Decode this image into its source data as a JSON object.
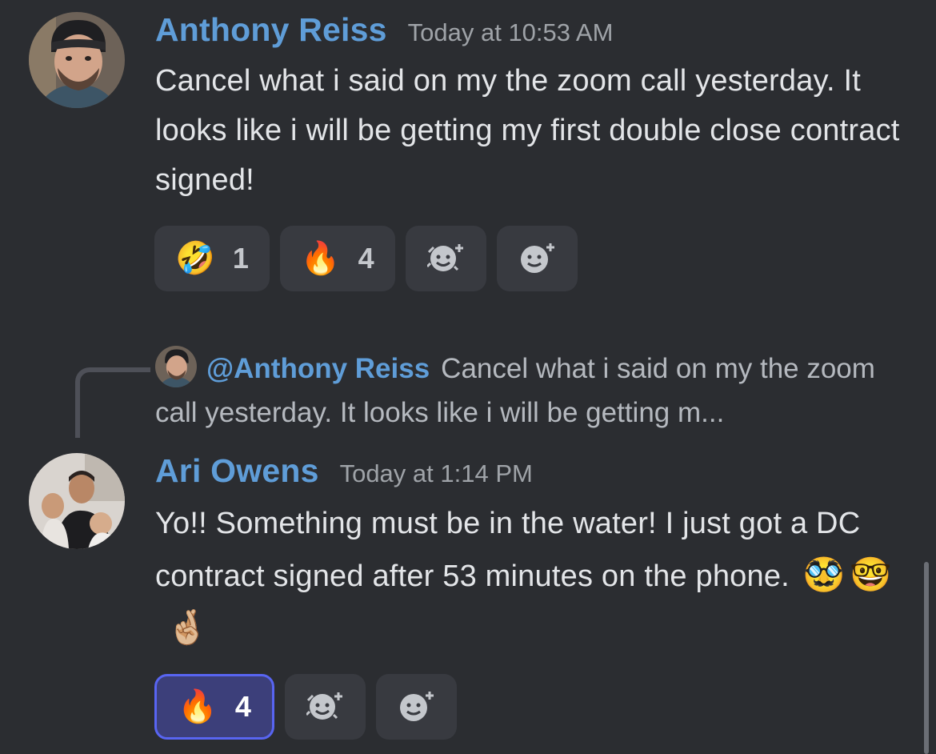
{
  "messages": [
    {
      "author": "Anthony Reiss",
      "timestamp": "Today at 10:53 AM",
      "text": "Cancel what i said on my the zoom call yesterday. It looks like i will be getting my first double close contract signed!",
      "reactions": [
        {
          "emoji": "🤣",
          "count": "1"
        },
        {
          "emoji": "🔥",
          "count": "4"
        }
      ]
    },
    {
      "author": "Ari Owens",
      "timestamp": "Today at 1:14 PM",
      "text": "Yo!! Something must be in the water! I just got a DC contract signed after 53 minutes on the phone.",
      "inline_emojis": [
        "🥸",
        "🤓",
        "🤞🏼"
      ],
      "reply": {
        "mention": "@Anthony Reiss",
        "preview": "Cancel what i said on my the zoom call yesterday. It looks like i will be getting m..."
      },
      "reactions": [
        {
          "emoji": "🔥",
          "count": "4"
        }
      ]
    }
  ],
  "icons": {
    "add_reaction": "add-reaction-icon",
    "add_super_reaction": "add-super-reaction-icon"
  },
  "colors": {
    "background": "#2b2d31",
    "author": "#5f9dd8",
    "active_reaction_border": "#5865f2"
  }
}
